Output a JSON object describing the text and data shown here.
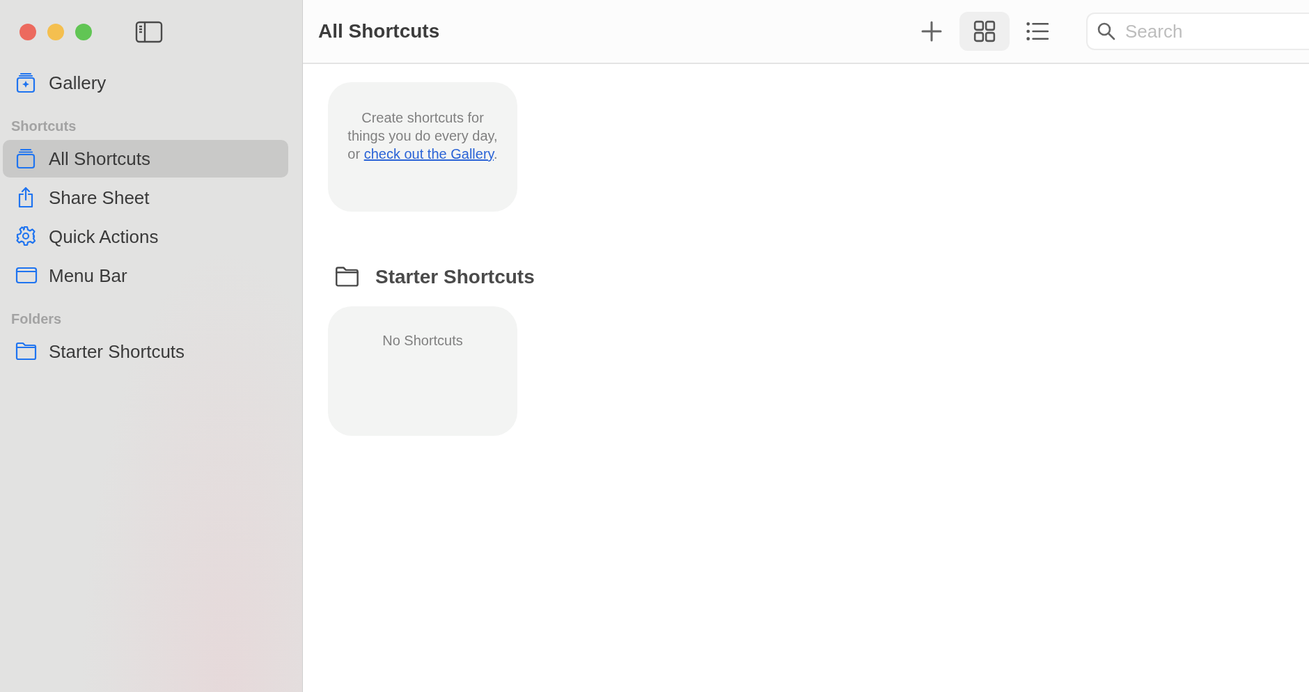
{
  "window": {
    "title": "All Shortcuts"
  },
  "sidebar": {
    "top_items": [
      {
        "label": "Gallery",
        "kind": "gallery",
        "selected": false
      }
    ],
    "sections": [
      {
        "header": "Shortcuts",
        "items": [
          {
            "label": "All Shortcuts",
            "kind": "stack",
            "selected": true
          },
          {
            "label": "Share Sheet",
            "kind": "share",
            "selected": false
          },
          {
            "label": "Quick Actions",
            "kind": "gear",
            "selected": false
          },
          {
            "label": "Menu Bar",
            "kind": "window",
            "selected": false
          }
        ]
      },
      {
        "header": "Folders",
        "items": [
          {
            "label": "Starter Shortcuts",
            "kind": "folder",
            "selected": false
          }
        ]
      }
    ]
  },
  "toolbar": {
    "view_modes": [
      {
        "kind": "grid",
        "selected": true
      },
      {
        "kind": "list",
        "selected": false
      }
    ],
    "search": {
      "placeholder": "Search"
    }
  },
  "intro_card": {
    "text": "Create shortcuts for things you do every day, or ",
    "link": "check out the Gallery",
    "after": "."
  },
  "folders": [
    {
      "title": "Starter Shortcuts",
      "empty_text": "No Shortcuts"
    }
  ]
}
